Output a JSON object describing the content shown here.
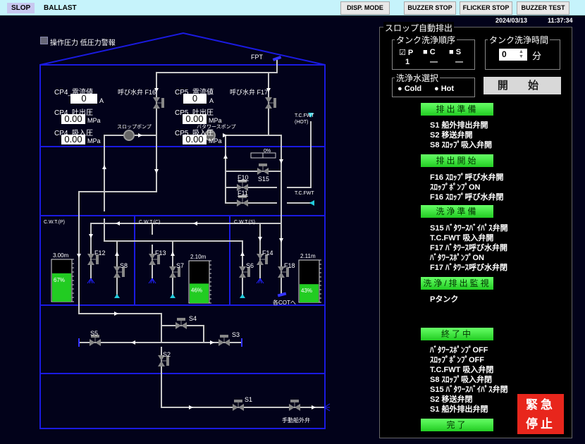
{
  "topbar": {
    "tabs": [
      "SLOP",
      "BALLAST"
    ],
    "buttons": [
      "DISP. MODE",
      "BUZZER STOP",
      "FLICKER STOP",
      "BUZZER TEST"
    ],
    "date": "2024/03/13",
    "time": "11:37:34"
  },
  "alarm": {
    "label": "操作圧力 低圧力警報"
  },
  "diagram": {
    "fpt": "FPT",
    "f16": "呼び水弁 F16",
    "f17": "呼び水弁 F17",
    "cp4": {
      "current_label": "CP4_電流値",
      "current": "0",
      "current_unit": "A",
      "discharge_label": "CP4_吐出圧",
      "discharge": "0.00",
      "suction_label": "CP4_吸入圧",
      "suction": "0.00",
      "unit": "MPa"
    },
    "cp5": {
      "current_label": "CP5_電流値",
      "current": "0",
      "current_unit": "A",
      "discharge_label": "CP5_吐出圧",
      "discharge": "0.00",
      "suction_label": "CP5_吸入圧",
      "suction": "0.00",
      "unit": "MPa"
    },
    "slop_pump": "スロップポンプ",
    "bw_pump": "バタワースポンプ",
    "tcfwt_hot": "T.C.FWT",
    "tcfwt_hot2": "(HOT)",
    "tcfwt": "T.C.FWT",
    "s15_open": "0%",
    "valves": {
      "S15": "S15",
      "F10": "F10",
      "F11": "F11",
      "F12": "F12",
      "S8": "S8",
      "F13": "F13",
      "S7": "S7",
      "S6": "S6",
      "F14": "F14",
      "F18": "F18",
      "S5": "S5",
      "S4": "S4",
      "S3": "S3",
      "S2": "S2",
      "S1": "S1"
    },
    "tanks": [
      {
        "name": "C.W.T.(P)",
        "level": "3.00m",
        "percent_label": "67%",
        "percent": 67
      },
      {
        "name": "C.W.T.(C)",
        "level": "2.10m",
        "percent_label": "46%",
        "percent": 46
      },
      {
        "name": "C.W.T.(S)",
        "level": "2.11m",
        "percent_label": "43%",
        "percent": 43
      }
    ],
    "to_cot": "各COTへ",
    "manual_valve": "手動船外弁"
  },
  "panel": {
    "title": "スロップ自動排出",
    "order": {
      "title": "タンク洗浄順序",
      "items": [
        {
          "label": "P",
          "checked": true,
          "seq": "1"
        },
        {
          "label": "C",
          "checked": false,
          "seq": "—"
        },
        {
          "label": "S",
          "checked": false,
          "seq": "—"
        }
      ]
    },
    "time": {
      "title": "タンク洗浄時間",
      "value": "0",
      "unit": "分"
    },
    "water": {
      "title": "洗浄水選択",
      "options": [
        "Cold",
        "Hot"
      ]
    },
    "start": "開 始",
    "stages": [
      {
        "label": "排出準備",
        "steps": [
          "S1 船外排出弁開",
          "S2 移送弁開",
          "S8 ｽﾛｯﾌﾟ吸入弁開"
        ]
      },
      {
        "label": "排出開始",
        "steps": [
          "F16 ｽﾛｯﾌﾟ呼び水弁開",
          "ｽﾛｯﾌﾟﾎﾟﾝﾌﾟON",
          "F16 ｽﾛｯﾌﾟ呼び水弁閉"
        ]
      },
      {
        "label": "洗浄準備",
        "steps": [
          "S15 ﾊﾞﾀﾜｰｽﾊﾞｲﾊﾟｽ弁開",
          "T.C.FWT 吸入弁開",
          "F17 ﾊﾞﾀﾜｰｽ呼び水弁開",
          "ﾊﾞﾀﾜｰｽﾎﾟﾝﾌﾟON",
          "F17 ﾊﾞﾀﾜｰｽ呼び水弁閉"
        ]
      },
      {
        "label": "洗浄/排出監視",
        "steps": [
          "Pタンク"
        ]
      },
      {
        "label": "終了中",
        "steps": [
          "ﾊﾞﾀﾜｰｽﾎﾟﾝﾌﾟOFF",
          "ｽﾛｯﾌﾟﾎﾟﾝﾌﾟOFF",
          "T.C.FWT 吸入弁閉",
          "S8 ｽﾛｯﾌﾟ吸入弁閉",
          "S15 ﾊﾞﾀﾜｰｽﾊﾞｲﾊﾟｽ弁閉",
          "S2 移送弁閉",
          "S1 船外排出弁閉"
        ]
      },
      {
        "label": "完了",
        "steps": []
      }
    ],
    "estop": [
      "緊急",
      "停止"
    ]
  },
  "colors": {
    "pipe": "#c8c8c8",
    "frame": "#1a1ae0",
    "tank_fill": "#22cc22",
    "stage_button": "#33dd33",
    "estop": "#e8261c"
  }
}
